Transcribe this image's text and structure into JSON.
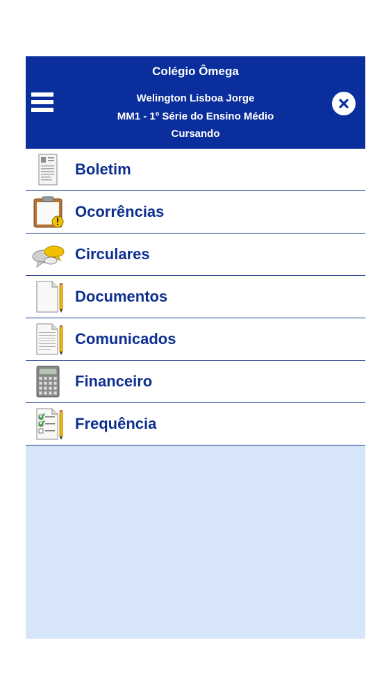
{
  "header": {
    "school_name": "Colégio Ômega",
    "student_name": "Welington Lisboa Jorge",
    "class_info": "MM1 - 1º Série do Ensino Médio",
    "status": "Cursando"
  },
  "menu": {
    "items": [
      {
        "label": "Boletim",
        "icon": "report-card-icon"
      },
      {
        "label": "Ocorrências",
        "icon": "clipboard-warning-icon"
      },
      {
        "label": "Circulares",
        "icon": "speech-bubbles-icon"
      },
      {
        "label": "Documentos",
        "icon": "document-pencil-icon"
      },
      {
        "label": "Comunicados",
        "icon": "lined-document-pencil-icon"
      },
      {
        "label": "Financeiro",
        "icon": "calculator-icon"
      },
      {
        "label": "Frequência",
        "icon": "checklist-icon"
      }
    ]
  },
  "colors": {
    "header_bg": "#0a2e9c",
    "menu_text": "#0d2f8f",
    "empty_area_bg": "#d6e5f7"
  }
}
